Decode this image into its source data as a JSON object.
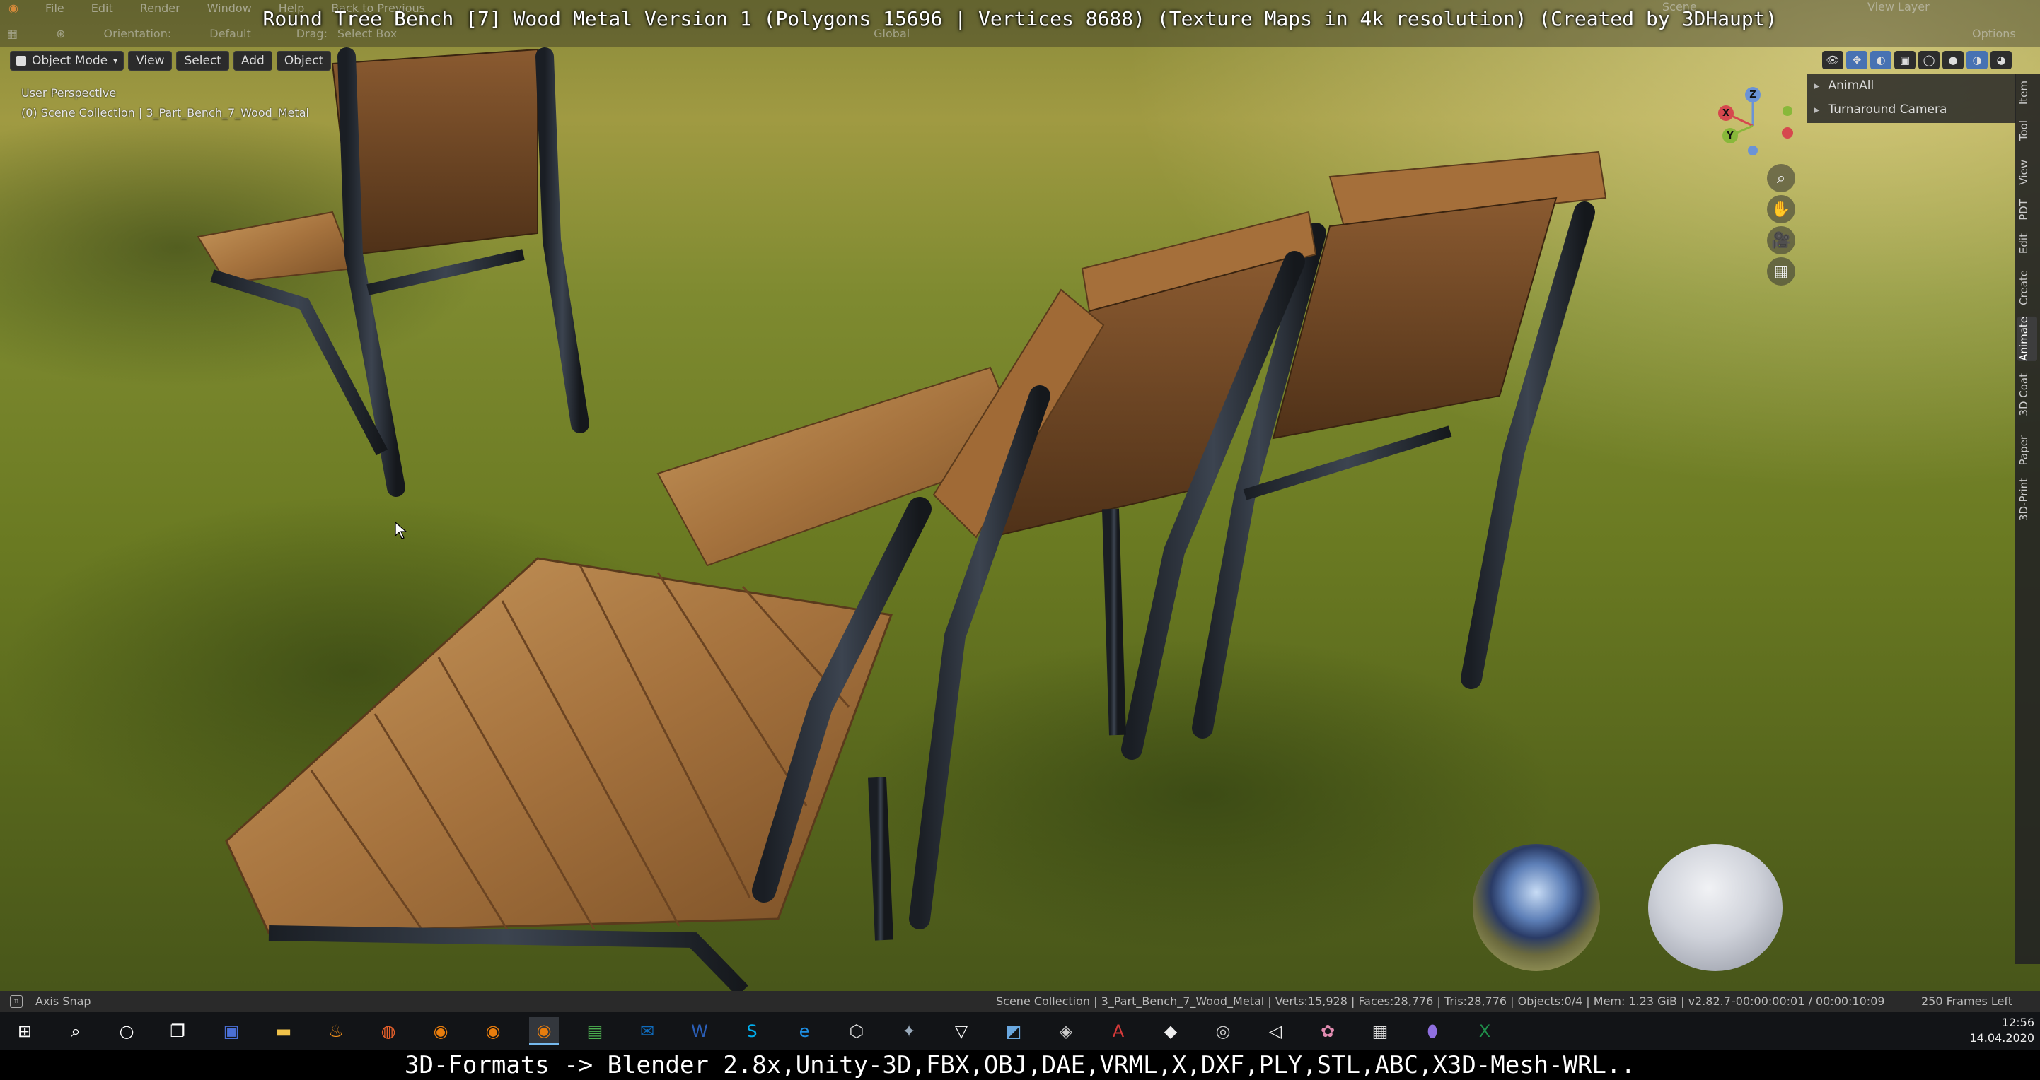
{
  "app": {
    "menu": [
      "File",
      "Edit",
      "Render",
      "Window",
      "Help"
    ],
    "back_to_previous": "Back to Previous",
    "scene": "Scene",
    "view_layer": "View Layer",
    "toolbar_row": {
      "orientation_label": "Orientation:",
      "orientation_value": "Default",
      "drag_label": "Drag:",
      "drag_value": "Select Box",
      "transform_value": "Global",
      "options_label": "Options"
    }
  },
  "title_overlay": "Round Tree Bench [7] Wood Metal Version 1 (Polygons 15696 | Vertices 8688) (Texture Maps in 4k resolution) (Created by 3DHaupt)",
  "viewport": {
    "mode": "Object Mode",
    "header_menus": [
      "View",
      "Select",
      "Add",
      "Object"
    ],
    "perspective": "User Perspective",
    "collection_info": "(0) Scene Collection | 3_Part_Bench_7_Wood_Metal"
  },
  "outliner": {
    "items": [
      "AnimAll",
      "Turnaround Camera"
    ]
  },
  "gizmo": {
    "x": "X",
    "y": "Y",
    "z": "Z"
  },
  "side_tabs": [
    "Item",
    "Tool",
    "View",
    "PDT",
    "Edit",
    "Create",
    "Animate",
    "3D Coat",
    "Paper",
    "3D-Print"
  ],
  "status": {
    "left": "Axis Snap",
    "scene_stats": "Scene Collection | 3_Part_Bench_7_Wood_Metal | Verts:15,928 | Faces:28,776 | Tris:28,776 | Objects:0/4 | Mem: 1.23 GiB | v2.82.7",
    "timecode": "-00:00:00:01 / 00:00:10:09",
    "frames_left": "250 Frames Left"
  },
  "clock": {
    "time": "12:56",
    "date": "14.04.2020"
  },
  "taskbar_icons": [
    "windows-start-icon",
    "search-icon",
    "cortana-icon",
    "task-view-icon",
    "save-icon",
    "file-explorer-icon",
    "flame-app-icon",
    "firefox-icon",
    "blender-icon",
    "blender-icon",
    "blender-icon",
    "spreadsheet-app-icon",
    "outlook-icon",
    "word-icon",
    "skype-icon",
    "edge-icon",
    "box-3d-icon",
    "tool-app-icon",
    "vectorworks-icon",
    "photo-app-icon",
    "cube-app-icon",
    "acrobat-icon",
    "unity-icon",
    "obs-icon",
    "unity-hub-icon",
    "paint-icon",
    "calculator-icon",
    "maps-icon",
    "excel-icon"
  ],
  "caption": "3D-Formats -> Blender 2.8x,Unity-3D,FBX,OBJ,DAE,VRML,X,DXF,PLY,STL,ABC,X3D-Mesh-WRL.."
}
